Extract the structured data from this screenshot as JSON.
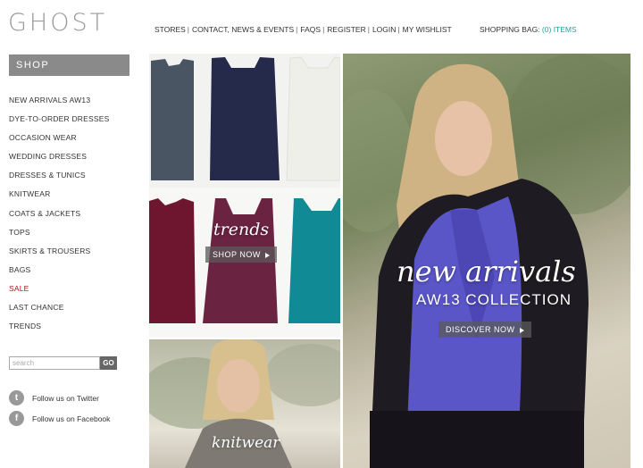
{
  "brand": {
    "logo": "GHOST"
  },
  "topnav": {
    "items": [
      "STORES",
      "CONTACT, NEWS & EVENTS",
      "FAQS",
      "REGISTER",
      "LOGIN",
      "MY WISHLIST"
    ]
  },
  "bag": {
    "label": "SHOPPING BAG:",
    "count": "(0)",
    "items_label": "ITEMS"
  },
  "sidebar": {
    "header": "SHOP",
    "items": [
      "NEW ARRIVALS AW13",
      "DYE-TO-ORDER DRESSES",
      "OCCASION WEAR",
      "WEDDING DRESSES",
      "DRESSES & TUNICS",
      "KNITWEAR",
      "COATS & JACKETS",
      "TOPS",
      "SKIRTS & TROUSERS",
      "BAGS",
      "SALE",
      "LAST CHANCE",
      "TRENDS"
    ],
    "sale_color": "#b3111b"
  },
  "search": {
    "placeholder": "search",
    "button": "GO"
  },
  "social": {
    "twitter": "Follow us on Twitter",
    "facebook": "Follow us on Facebook"
  },
  "promos": {
    "trends": {
      "title": "trends",
      "button": "SHOP NOW"
    },
    "knitwear": {
      "title": "knitwear"
    },
    "new_arrivals": {
      "title": "new arrivals",
      "subtitle": "AW13 COLLECTION",
      "button": "DISCOVER NOW"
    }
  },
  "colors": {
    "accent_teal": "#2a9d9b",
    "sidebar_header_bg": "#8a8a8a",
    "garments": [
      "#4a5563",
      "#262a4a",
      "#efefea",
      "#6e1530",
      "#6b2342",
      "#108a95"
    ]
  }
}
